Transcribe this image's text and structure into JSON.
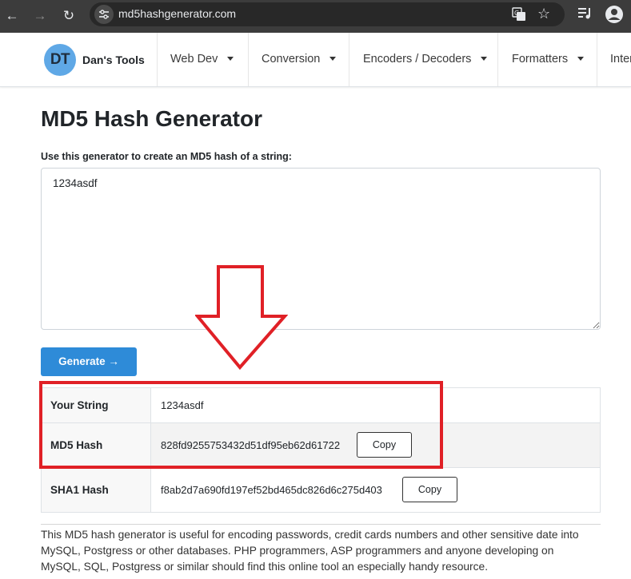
{
  "browser": {
    "url": "md5hashgenerator.com",
    "icons": [
      "back-icon",
      "forward-icon",
      "reload-icon",
      "site-info-icon",
      "translate-icon",
      "star-icon",
      "media-icon",
      "profile-icon"
    ]
  },
  "navbar": {
    "logo_initials": "DT",
    "brand": "Dan's Tools",
    "items": [
      {
        "label": "Web Dev"
      },
      {
        "label": "Conversion"
      },
      {
        "label": "Encoders / Decoders"
      },
      {
        "label": "Formatters"
      },
      {
        "label": "Inter"
      }
    ]
  },
  "main": {
    "title": "MD5 Hash Generator",
    "intro": "Use this generator to create an MD5 hash of a string:",
    "input_value": "1234asdf",
    "generate_label": "Generate →"
  },
  "results": {
    "rows": [
      {
        "label": "Your String",
        "value": "1234asdf"
      },
      {
        "label": "MD5 Hash",
        "value": "828fd9255753432d51df95eb62d61722",
        "copy": "Copy"
      },
      {
        "label": "SHA1 Hash",
        "value": "f8ab2d7a690fd197ef52bd465dc826d6c275d403",
        "copy": "Copy"
      }
    ]
  },
  "description": "This MD5 hash generator is useful for encoding passwords, credit cards numbers and other sensitive date into MySQL, Postgress or other databases. PHP programmers, ASP programmers and anyone developing on MySQL, SQL, Postgress or similar should find this online tool an especially handy resource.",
  "colors": {
    "accent": "#2e8bd8",
    "annotation": "#e02026",
    "logo": "#5fa8e6"
  }
}
